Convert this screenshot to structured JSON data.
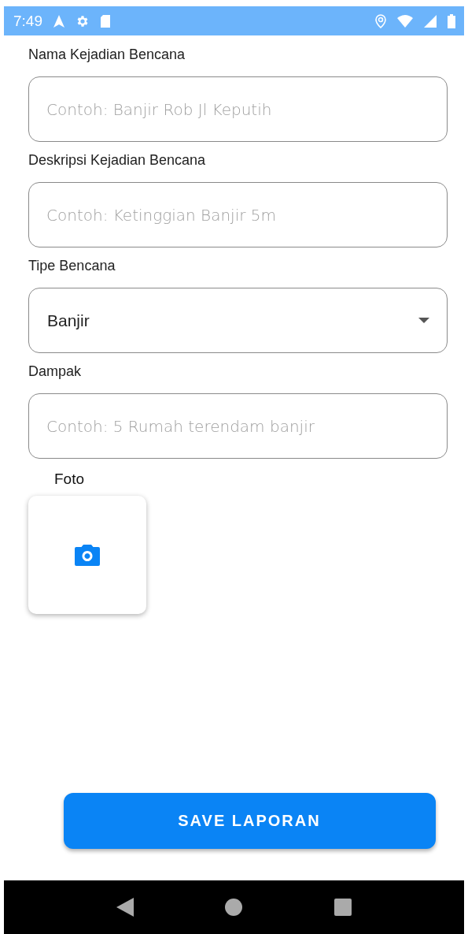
{
  "status_bar": {
    "time": "7:49"
  },
  "fields": [
    {
      "label": "Nama Kejadian Bencana",
      "kind": "text",
      "placeholder": "Contoh: Banjir Rob Jl Keputih"
    },
    {
      "label": "Deskripsi Kejadian Bencana",
      "kind": "text",
      "placeholder": "Contoh: Ketinggian Banjir 5m"
    },
    {
      "label": "Tipe Bencana",
      "kind": "dropdown",
      "value": "Banjir"
    },
    {
      "label": "Dampak",
      "kind": "text",
      "placeholder": "Contoh: 5 Rumah terendam banjir"
    }
  ],
  "photo": {
    "label": "Foto"
  },
  "save_button": "SAVE LAPORAN"
}
